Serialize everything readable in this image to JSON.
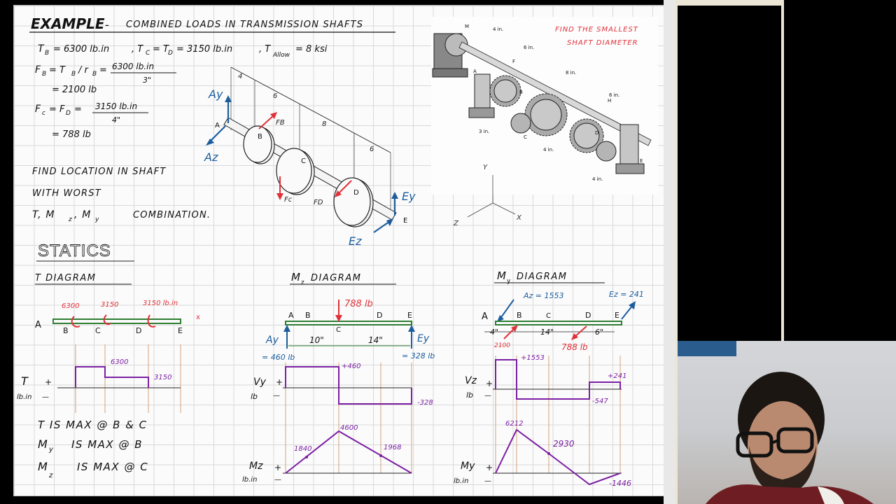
{
  "header": {
    "example": "EXAMPLE",
    "dash": "-",
    "title": "COMBINED LOADS IN TRANSMISSION SHAFTS"
  },
  "given": {
    "line1": "T₂ = 6300 lb.in , Tc = TD = 3150 lb.in , Tallow = 8 ksi",
    "tb": "T",
    "tb_sub": "B",
    "tb_val": "= 6300 lb.in",
    "tc": ", T",
    "tc_sub": "C",
    "td": "= T",
    "td_sub": "D",
    "td_val": "= 3150 lb.in",
    "tallow": ", T",
    "tallow_sub": "Allow",
    "tallow_val": "= 8 ksi",
    "fb_eq": "F",
    "fb_sub": "B",
    "fb_mid": "= T",
    "fb_mid_sub": "B",
    "fb_div": "/ r",
    "fb_div_sub": "B",
    "fb_eq2": "=",
    "fb_num": "6300 lb.in",
    "fb_den": "3\"",
    "fb_result": "= 2100 lb",
    "fc_eq": "F",
    "fc_sub": "c",
    "fc_eq_mid": "= F",
    "fc_mid_sub": "D",
    "fc_eq2": "=",
    "fc_num": "3150 lb.in",
    "fc_den": "4\"",
    "fc_result": "= 788 lb"
  },
  "task": {
    "line1": "FIND LOCATION IN SHAFT",
    "line2": "WITH WORST",
    "line3_a": "T, M",
    "line3_sub1": "z",
    "line3_b": ", M",
    "line3_sub2": "y",
    "line3_c": "COMBINATION."
  },
  "shaft_sketch": {
    "ay": "Ay",
    "az": "Az",
    "ey": "Ey",
    "ez": "Ez",
    "a": "A",
    "b": "B",
    "c": "C",
    "d": "D",
    "e": "E",
    "fb": "FB",
    "fc": "Fc",
    "fd": "FD",
    "dim4": "4",
    "dim6a": "6",
    "dim8": "8",
    "dim6b": "6"
  },
  "figure": {
    "note_line1": "FIND THE SMALLEST",
    "note_line2": "SHAFT DIAMETER",
    "m": "M",
    "f": "F",
    "a": "A",
    "h": "H",
    "e": "E",
    "c": "C",
    "b": "B",
    "d": "D",
    "d4in": "4 in.",
    "d6in": "6 in.",
    "d8in": "8 in.",
    "d6in2": "6 in.",
    "r3in": "3 in.",
    "r4in_a": "4 in.",
    "r4in_b": "4 in.",
    "axis_y": "Y",
    "axis_z": "Z",
    "axis_x": "X"
  },
  "statics": {
    "heading": "STATICS"
  },
  "t_diagram": {
    "title": "T DIAGRAM",
    "a": "A",
    "b": "B",
    "c": "C",
    "d": "D",
    "e": "E",
    "x": "x",
    "t6300": "6300",
    "t3150a": "3150",
    "t3150b": "3150 lb.in",
    "axis_t": "T",
    "axis_plus": "+",
    "axis_unit": "lb.in",
    "axis_minus": "—",
    "val6300": "6300",
    "val3150": "3150"
  },
  "mz_diagram": {
    "title": "Mz DIAGRAM",
    "title_m": "M",
    "title_sub": "z",
    "title_rest": "DIAGRAM",
    "a": "A",
    "b": "B",
    "c": "C",
    "d": "D",
    "e": "E",
    "force": "788 lb",
    "ay": "Ay",
    "ey": "Ey",
    "d10": "10\"",
    "d14": "14\"",
    "ay_val": "= 460 lb",
    "ey_val": "= 328 lb",
    "vy": "Vy",
    "vy_plus": "+",
    "vy_unit": "lb",
    "vy_minus": "—",
    "v_pos": "+460",
    "v_neg": "-328",
    "mz": "Mz",
    "mz_plus": "+",
    "mz_unit": "lb.in",
    "mz_minus": "—",
    "m1840": "1840",
    "m4600": "4600",
    "m1968": "1968"
  },
  "my_diagram": {
    "title_m": "M",
    "title_sub": "y",
    "title_rest": "DIAGRAM",
    "az": "Az = 1553",
    "ez": "Ez = 241",
    "a": "A",
    "b": "B",
    "c": "C",
    "d": "D",
    "e": "E",
    "d4": "4\"",
    "d14": "14\"",
    "d6": "6\"",
    "f2100": "2100",
    "f788": "788 lb",
    "vz": "Vz",
    "vz_plus": "+",
    "vz_unit": "lb",
    "vz_minus": "—",
    "v1553": "+1553",
    "v241": "+241",
    "v547": "-547",
    "my": "My",
    "my_plus": "+",
    "my_unit": "lb.in",
    "my_minus": "—",
    "m6212": "6212",
    "m2930": "2930",
    "m1446": "-1446"
  },
  "conclusions": {
    "line1": "T IS MAX @ B & C",
    "line2_m": "M",
    "line2_sub": "y",
    "line2_rest": "IS MAX @ B",
    "line3_m": "M",
    "line3_sub": "z",
    "line3_rest": "IS MAX @ C"
  },
  "colors": {
    "ink": "#1a1a1a",
    "red": "#e0313a",
    "blue": "#1d5d9e",
    "purple": "#7b1fa2",
    "green": "#2e7d32",
    "grid": "#d9d9d9"
  }
}
